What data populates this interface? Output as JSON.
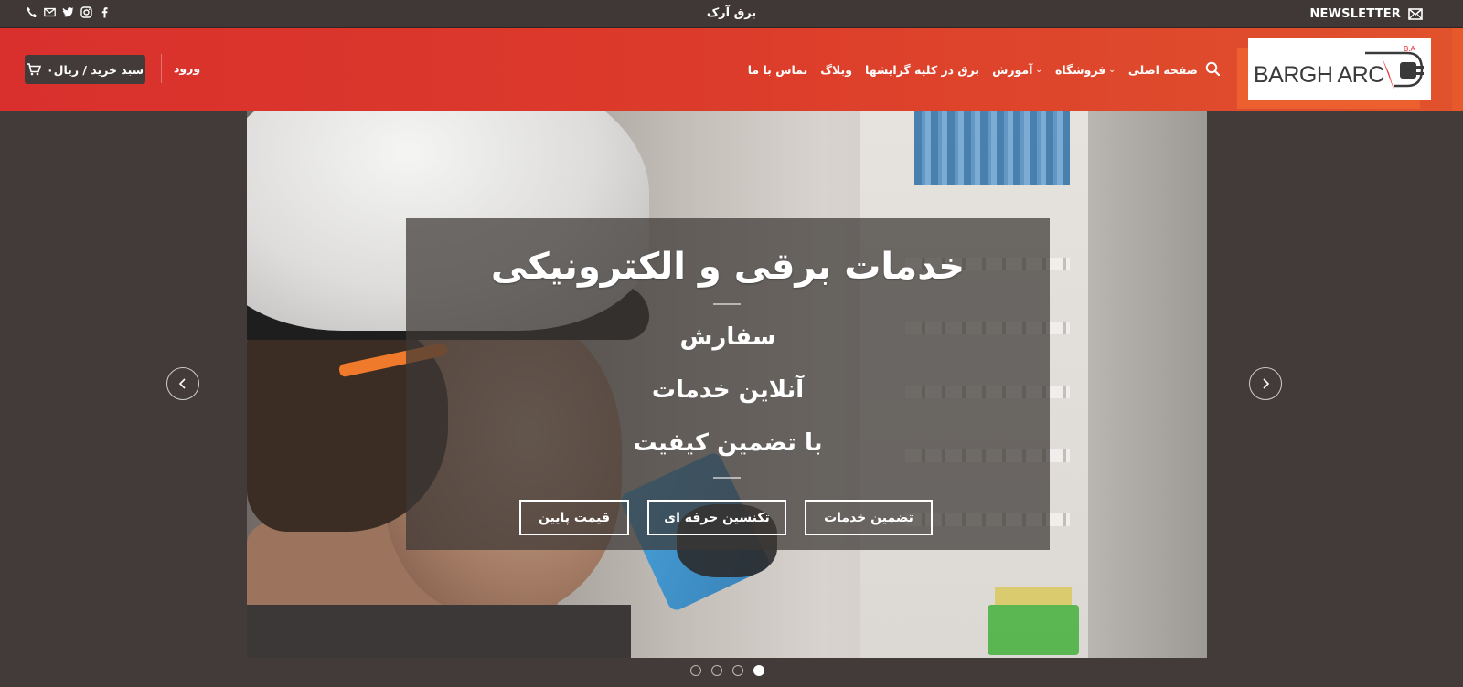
{
  "topbar": {
    "newsletter_label": "NEWSLETTER",
    "site_name": "برق آرک",
    "socials": [
      "facebook-icon",
      "instagram-icon",
      "twitter-icon",
      "email-icon",
      "phone-icon"
    ]
  },
  "header": {
    "logo_text": "BARGH ARC",
    "logo_badge": "B.A",
    "nav": [
      {
        "label": "صفحه اصلی",
        "dropdown": false
      },
      {
        "label": "فروشگاه",
        "dropdown": true
      },
      {
        "label": "آموزش",
        "dropdown": true
      },
      {
        "label": "برق در کلیه گرایشها",
        "dropdown": false
      },
      {
        "label": "وبلاگ",
        "dropdown": false
      },
      {
        "label": "تماس با ما",
        "dropdown": false
      }
    ],
    "login_label": "ورود",
    "cart_label": "سبد خرید / ریال۰"
  },
  "hero": {
    "title": "خدمات برقی و الکترونیکی",
    "lines": [
      "سفارش",
      "آنلاین خدمات",
      "با تضمین کیفیت"
    ],
    "buttons": [
      "تضمین خدمات",
      "تکنسین حرفه ای",
      "قیمت پایین"
    ],
    "slides": 4,
    "active_slide": 4
  },
  "colors": {
    "header_red": "#d9302d",
    "header_orange": "#e0522c",
    "background": "#423b39",
    "logo_accent": "#e8262b"
  }
}
